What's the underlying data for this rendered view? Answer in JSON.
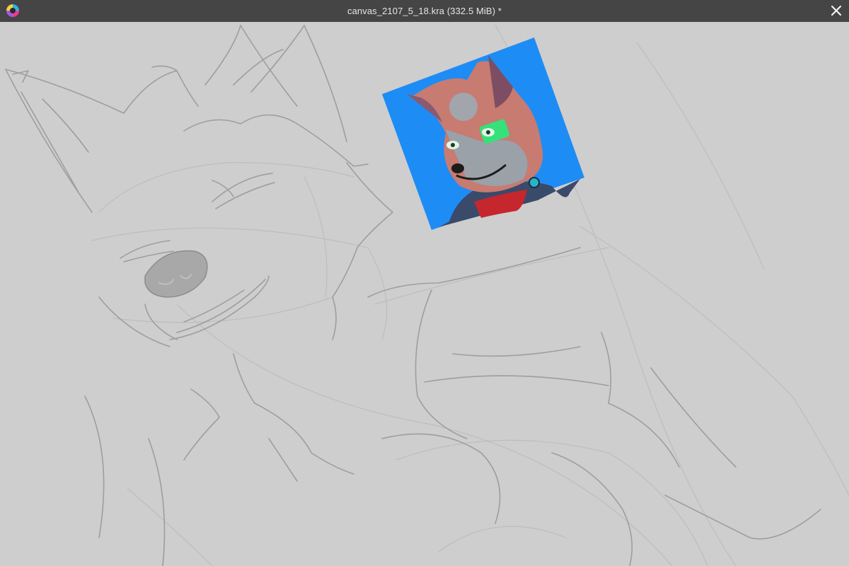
{
  "window": {
    "title": "canvas_2107_5_18.kra (332.5 MiB) *",
    "app_icon": "krita-logo-icon",
    "close_icon": "close-icon",
    "titlebar_color": "#454545",
    "canvas_color": "#cecece"
  },
  "canvas": {
    "sketch": "wolf-sketch-lines",
    "reference_image": "wolf-character-reference",
    "reference_background": "#1e8cf5"
  }
}
